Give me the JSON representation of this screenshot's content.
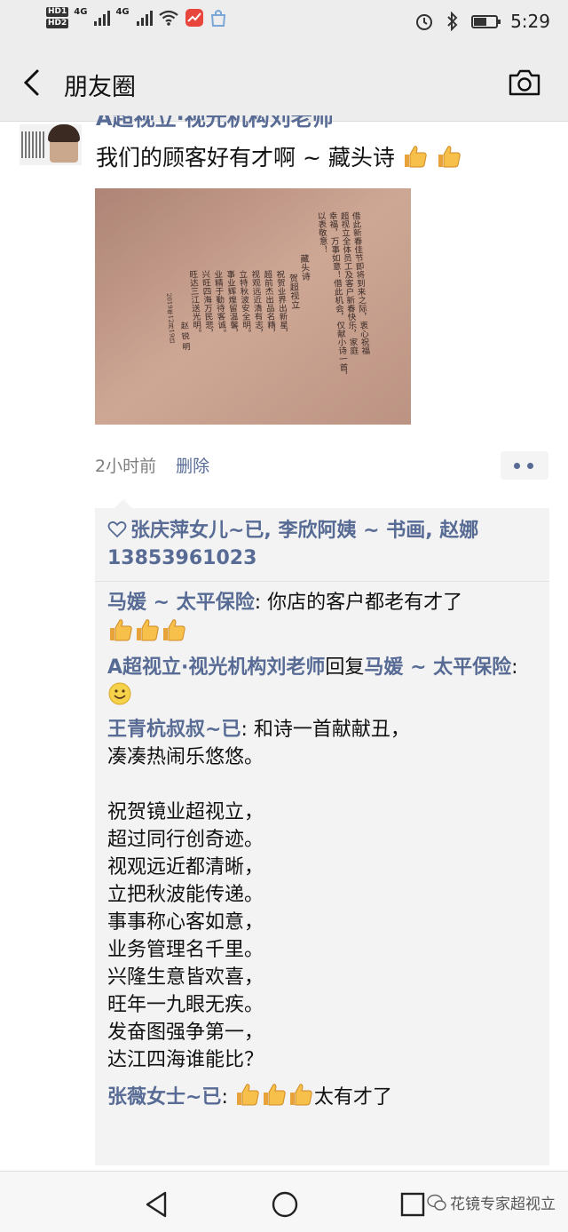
{
  "status_bar": {
    "hd_badges": [
      "HD1",
      "HD2"
    ],
    "signal_labels": [
      "4G",
      "4G"
    ],
    "time": "5:29",
    "battery_level": 0.55
  },
  "header": {
    "title": "朋友圈"
  },
  "post": {
    "nickname": "A超视立·视光机构刘老师",
    "text": "我们的顾客好有才啊 ~ 藏头诗",
    "time_ago": "2小时前",
    "delete_label": "删除",
    "image_poem": {
      "heading_lines": [
        "借此新春佳节即将到来之际，衷心祝福",
        "超视立全体员工及客户新春快乐，家庭",
        "幸福，万事如意！借此机会，仅献小诗一首，",
        "以表敬意！"
      ],
      "poem_title": "藏头诗",
      "poem_subtitle": "贺超视立",
      "poem_lines": [
        "祝贺业界出新星，",
        "超前杰出品名精，",
        "视观远近清有志，",
        "立特秋波安全明。",
        "事业辉煌留温馨，",
        "业精于勤待客诚。",
        "兴旺四海万民悲，",
        "旺达三江送光明。"
      ],
      "signature": "赵 锐 明",
      "date": "2019年12月19日"
    }
  },
  "likes": {
    "text": "张庆萍女儿~已, 李欣阿姨 ~ 书画, 赵娜13853961023"
  },
  "comments": [
    {
      "name": "马媛 ~ 太平保险",
      "text": ": 你店的客户都老有才了",
      "thumbs": 3
    },
    {
      "name": "A超视立·视光机构刘老师",
      "reply_word": "回复",
      "reply_to": "马媛 ~ 太平保险",
      "text": ": ",
      "emoji": "smile"
    },
    {
      "name": "王青杭叔叔~已",
      "text": ": 和诗一首献献丑，\n凑凑热闹乐悠悠。\n\n祝贺镜业超视立，\n超过同行创奇迹。\n视观远近都清晰，\n立把秋波能传递。\n事事称心客如意，\n业务管理名千里。\n兴隆生意皆欢喜，\n旺年一九眼无疾。\n发奋图强争第一，\n达江四海谁能比？"
    },
    {
      "name": "张薇女士~已",
      "text": ": ",
      "thumbs": 3,
      "after": "太有才了"
    }
  ],
  "watermark": {
    "text": "花镜专家超视立"
  },
  "colors": {
    "link": "#576b95",
    "header_bg": "#ededed",
    "comment_bg": "#f3f3f3"
  },
  "icons": [
    "back-arrow-icon",
    "camera-icon",
    "heart-icon",
    "thumbs-up-icon",
    "smile-icon",
    "nav-back-icon",
    "nav-home-icon",
    "nav-recent-icon",
    "wechat-icon"
  ]
}
